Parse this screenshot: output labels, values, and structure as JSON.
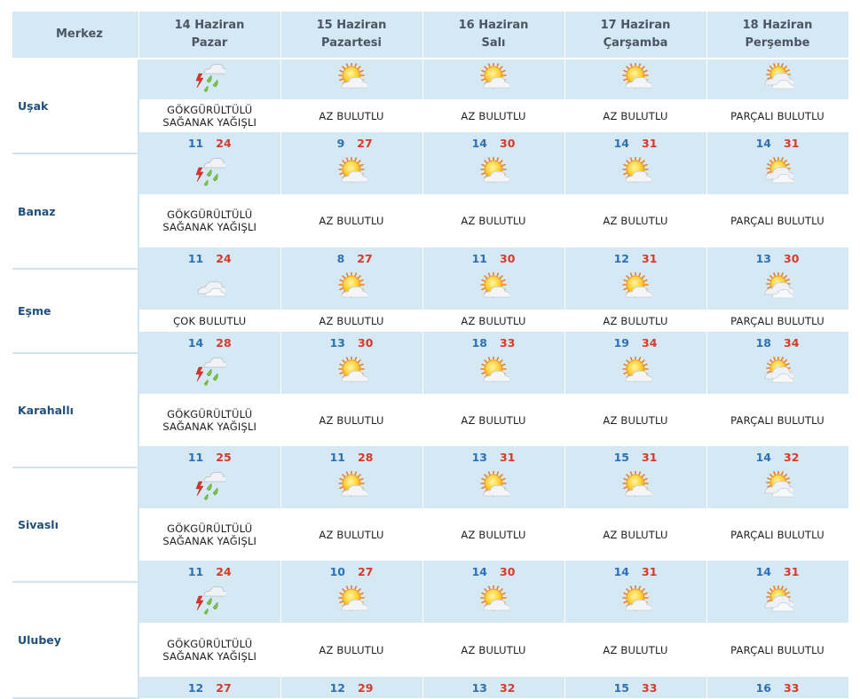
{
  "header": {
    "merkez": "Merkez",
    "days": [
      {
        "date": "14 Haziran",
        "weekday": "Pazar"
      },
      {
        "date": "15 Haziran",
        "weekday": "Pazartesi"
      },
      {
        "date": "16 Haziran",
        "weekday": "Salı"
      },
      {
        "date": "17 Haziran",
        "weekday": "Çarşamba"
      },
      {
        "date": "18 Haziran",
        "weekday": "Perşembe"
      }
    ]
  },
  "colors": {
    "header_bg": "#d4e9f3",
    "low": "#2f6fb4",
    "high": "#d63a2a",
    "city": "#1f4f7a"
  },
  "rows": [
    {
      "city": "Uşak",
      "days": [
        {
          "icon": "thunderstorm-icon",
          "desc1": "GÖKGÜRÜLTÜLÜ",
          "desc2": "SAĞANAK YAĞIŞLI",
          "lo": "11",
          "hi": "24"
        },
        {
          "icon": "partly-sunny-icon",
          "desc1": "AZ BULUTLU",
          "desc2": "",
          "lo": "9",
          "hi": "27"
        },
        {
          "icon": "partly-sunny-icon",
          "desc1": "AZ BULUTLU",
          "desc2": "",
          "lo": "14",
          "hi": "30"
        },
        {
          "icon": "partly-sunny-icon",
          "desc1": "AZ BULUTLU",
          "desc2": "",
          "lo": "14",
          "hi": "31"
        },
        {
          "icon": "mostly-cloudy-sun-icon",
          "desc1": "PARÇALI BULUTLU",
          "desc2": "",
          "lo": "14",
          "hi": "31"
        }
      ]
    },
    {
      "city": "Banaz",
      "days": [
        {
          "icon": "thunderstorm-icon",
          "desc1": "GÖKGÜRÜLTÜLÜ",
          "desc2": "SAĞANAK YAĞIŞLI",
          "lo": "11",
          "hi": "24"
        },
        {
          "icon": "partly-sunny-icon",
          "desc1": "AZ BULUTLU",
          "desc2": "",
          "lo": "8",
          "hi": "27"
        },
        {
          "icon": "partly-sunny-icon",
          "desc1": "AZ BULUTLU",
          "desc2": "",
          "lo": "11",
          "hi": "30"
        },
        {
          "icon": "partly-sunny-icon",
          "desc1": "AZ BULUTLU",
          "desc2": "",
          "lo": "12",
          "hi": "31"
        },
        {
          "icon": "mostly-cloudy-sun-icon",
          "desc1": "PARÇALI BULUTLU",
          "desc2": "",
          "lo": "13",
          "hi": "30"
        }
      ]
    },
    {
      "city": "Eşme",
      "days": [
        {
          "icon": "cloudy-icon",
          "desc1": "ÇOK BULUTLU",
          "desc2": "",
          "lo": "14",
          "hi": "28"
        },
        {
          "icon": "partly-sunny-icon",
          "desc1": "AZ BULUTLU",
          "desc2": "",
          "lo": "13",
          "hi": "30"
        },
        {
          "icon": "partly-sunny-icon",
          "desc1": "AZ BULUTLU",
          "desc2": "",
          "lo": "18",
          "hi": "33"
        },
        {
          "icon": "partly-sunny-icon",
          "desc1": "AZ BULUTLU",
          "desc2": "",
          "lo": "19",
          "hi": "34"
        },
        {
          "icon": "mostly-cloudy-sun-icon",
          "desc1": "PARÇALI BULUTLU",
          "desc2": "",
          "lo": "18",
          "hi": "34"
        }
      ]
    },
    {
      "city": "Karahallı",
      "days": [
        {
          "icon": "thunderstorm-icon",
          "desc1": "GÖKGÜRÜLTÜLÜ",
          "desc2": "SAĞANAK YAĞIŞLI",
          "lo": "11",
          "hi": "25"
        },
        {
          "icon": "partly-sunny-icon",
          "desc1": "AZ BULUTLU",
          "desc2": "",
          "lo": "11",
          "hi": "28"
        },
        {
          "icon": "partly-sunny-icon",
          "desc1": "AZ BULUTLU",
          "desc2": "",
          "lo": "13",
          "hi": "31"
        },
        {
          "icon": "partly-sunny-icon",
          "desc1": "AZ BULUTLU",
          "desc2": "",
          "lo": "15",
          "hi": "31"
        },
        {
          "icon": "mostly-cloudy-sun-icon",
          "desc1": "PARÇALI BULUTLU",
          "desc2": "",
          "lo": "14",
          "hi": "32"
        }
      ]
    },
    {
      "city": "Sivaslı",
      "days": [
        {
          "icon": "thunderstorm-icon",
          "desc1": "GÖKGÜRÜLTÜLÜ",
          "desc2": "SAĞANAK YAĞIŞLI",
          "lo": "11",
          "hi": "24"
        },
        {
          "icon": "partly-sunny-icon",
          "desc1": "AZ BULUTLU",
          "desc2": "",
          "lo": "10",
          "hi": "27"
        },
        {
          "icon": "partly-sunny-icon",
          "desc1": "AZ BULUTLU",
          "desc2": "",
          "lo": "14",
          "hi": "30"
        },
        {
          "icon": "partly-sunny-icon",
          "desc1": "AZ BULUTLU",
          "desc2": "",
          "lo": "14",
          "hi": "31"
        },
        {
          "icon": "mostly-cloudy-sun-icon",
          "desc1": "PARÇALI BULUTLU",
          "desc2": "",
          "lo": "14",
          "hi": "31"
        }
      ]
    },
    {
      "city": "Ulubey",
      "days": [
        {
          "icon": "thunderstorm-icon",
          "desc1": "GÖKGÜRÜLTÜLÜ",
          "desc2": "SAĞANAK YAĞIŞLI",
          "lo": "12",
          "hi": "27"
        },
        {
          "icon": "partly-sunny-icon",
          "desc1": "AZ BULUTLU",
          "desc2": "",
          "lo": "12",
          "hi": "29"
        },
        {
          "icon": "partly-sunny-icon",
          "desc1": "AZ BULUTLU",
          "desc2": "",
          "lo": "13",
          "hi": "32"
        },
        {
          "icon": "partly-sunny-icon",
          "desc1": "AZ BULUTLU",
          "desc2": "",
          "lo": "15",
          "hi": "33"
        },
        {
          "icon": "mostly-cloudy-sun-icon",
          "desc1": "PARÇALI BULUTLU",
          "desc2": "",
          "lo": "16",
          "hi": "33"
        }
      ]
    }
  ]
}
